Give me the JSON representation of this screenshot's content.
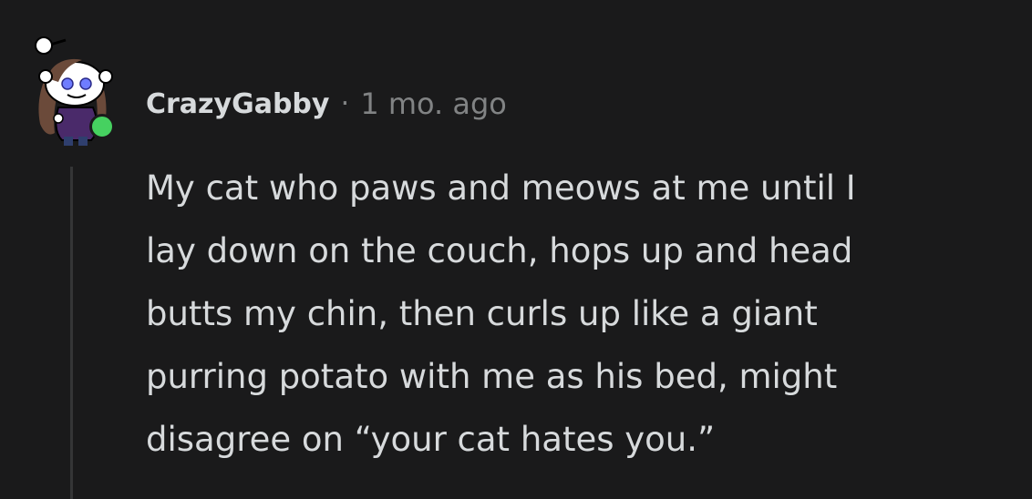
{
  "comment": {
    "author": "CrazyGabby",
    "separator": "·",
    "time": "1 mo. ago",
    "body": "My cat who paws and meows at me until I\nlay down on the couch, hops up and head\nbutts my chin, then curls up like a giant\npurring potato with me as his bed, might\ndisagree on “your cat hates you.”"
  },
  "avatar": {
    "icon": "snoo-avatar-icon",
    "online_status": "online"
  },
  "colors": {
    "background": "#1a1a1b",
    "text": "#d7dadc",
    "meta": "#818384",
    "online": "#46d160",
    "thread_line": "#343536"
  }
}
